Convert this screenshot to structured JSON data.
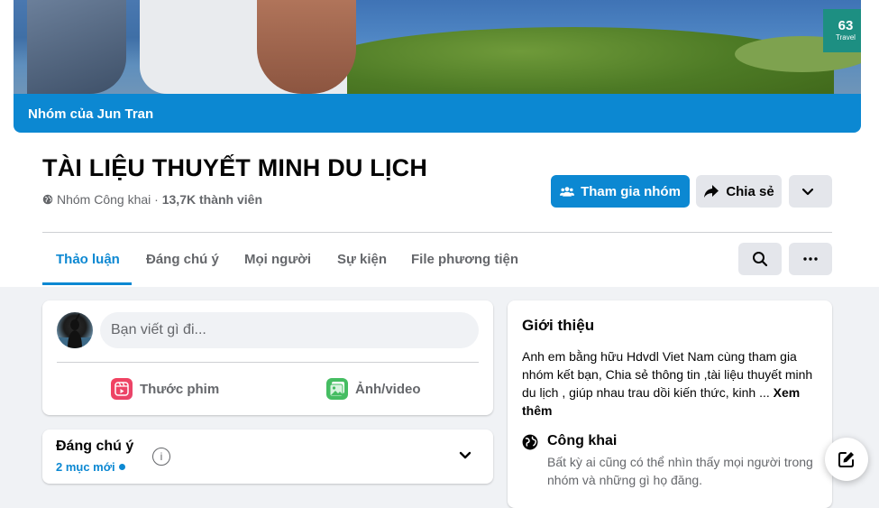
{
  "cover": {
    "owner_label": "Nhóm của Jun Tran",
    "brand_line1": "63",
    "brand_line2": "Travel"
  },
  "group": {
    "title": "TÀI LIỆU THUYẾT MINH DU LỊCH",
    "privacy": "Nhóm Công khai",
    "separator": " · ",
    "members": "13,7K thành viên"
  },
  "actions": {
    "join_label": "Tham gia nhóm",
    "share_label": "Chia sẻ"
  },
  "tabs": [
    {
      "label": "Thảo luận",
      "active": true
    },
    {
      "label": "Đáng chú ý"
    },
    {
      "label": "Mọi người"
    },
    {
      "label": "Sự kiện"
    },
    {
      "label": "File phương tiện"
    }
  ],
  "composer": {
    "placeholder": "Bạn viết gì đi...",
    "reel_label": "Thước phim",
    "photo_label": "Ảnh/video"
  },
  "featured": {
    "title": "Đáng chú ý",
    "count_label": "2 mục mới"
  },
  "about": {
    "title": "Giới thiệu",
    "description": "Anh em bằng hữu Hdvdl Viet Nam cùng tham gia nhóm kết bạn, Chia sẻ thông tin ,tài liệu thuyết minh du lịch , giúp nhau trau dồi kiến thức, kinh ...",
    "see_more": "Xem thêm",
    "privacy_title": "Công khai",
    "privacy_desc": "Bất kỳ ai cũng có thể nhìn thấy mọi người trong nhóm và những gì họ đăng."
  },
  "colors": {
    "primary": "#0c88d2",
    "background": "#f0f2f5",
    "button_gray": "#e4e6eb"
  }
}
